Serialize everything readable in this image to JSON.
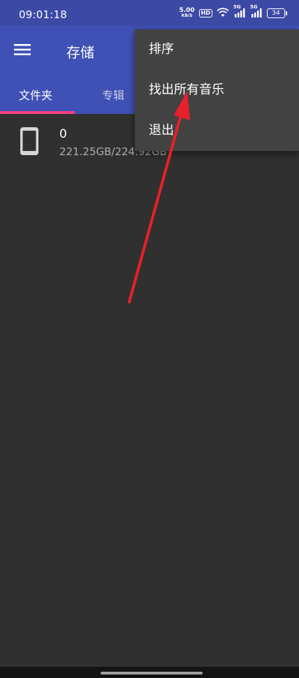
{
  "status_bar": {
    "time": "09:01:18",
    "net_speed_value": "5.00",
    "net_speed_unit": "KB/S",
    "hd_label": "HD",
    "signal1_label": "5G",
    "signal2_label": "5G",
    "battery_level": "34",
    "icons": [
      "wifi-icon",
      "signal-icon",
      "battery-icon"
    ]
  },
  "app_bar": {
    "title": "存储",
    "menu_icon": "hamburger-menu-icon",
    "tabs": [
      {
        "label": "文件夹",
        "selected": true
      },
      {
        "label": "专辑",
        "selected": false
      }
    ],
    "color": "#3f51b5",
    "indicator_color": "#ff4081"
  },
  "storage_list": [
    {
      "icon": "phone-icon",
      "title": "0",
      "subtitle": "221.25GB/224.92GB"
    }
  ],
  "overflow_menu": {
    "items": [
      {
        "label": "排序"
      },
      {
        "label": "找出所有音乐"
      },
      {
        "label": "退出"
      }
    ]
  },
  "annotation": {
    "type": "arrow",
    "color": "#e8202a",
    "target": "找出所有音乐"
  }
}
